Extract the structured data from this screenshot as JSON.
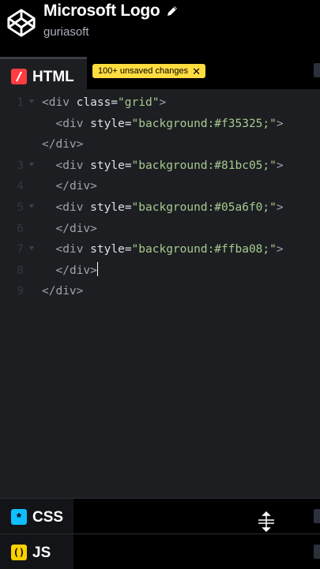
{
  "header": {
    "title": "Microsoft Logo",
    "author": "guriasoft",
    "logo_icon": "codepen-logo-icon",
    "edit_icon": "pencil-icon"
  },
  "html_panel": {
    "label": "HTML",
    "badge_glyph": "/",
    "badge_color": "#ff3c41",
    "unsaved_text": "100+ unsaved changes",
    "unsaved_close": "✕"
  },
  "editor": {
    "lines": [
      {
        "n": "1",
        "fold": true,
        "indent": 0,
        "parts": [
          [
            "tag",
            "<div "
          ],
          [
            "attr",
            "class"
          ],
          [
            "eq",
            "="
          ],
          [
            "str",
            "\"grid\""
          ],
          [
            "tag",
            ">"
          ]
        ]
      },
      {
        "n": "",
        "fold": false,
        "indent": 2,
        "parts": [
          [
            "tag",
            "<div "
          ],
          [
            "attr",
            "style"
          ],
          [
            "eq",
            "="
          ],
          [
            "str",
            "\"background:#f35325;\""
          ],
          [
            "tag",
            ">"
          ]
        ]
      },
      {
        "n": "",
        "fold": false,
        "indent": 0,
        "parts": [
          [
            "tag",
            "</div>"
          ]
        ]
      },
      {
        "n": "3",
        "fold": true,
        "indent": 2,
        "parts": [
          [
            "tag",
            "<div "
          ],
          [
            "attr",
            "style"
          ],
          [
            "eq",
            "="
          ],
          [
            "str",
            "\"background:#81bc05;\""
          ],
          [
            "tag",
            ">"
          ]
        ]
      },
      {
        "n": "4",
        "fold": false,
        "indent": 2,
        "parts": [
          [
            "tag",
            "</div>"
          ]
        ]
      },
      {
        "n": "5",
        "fold": true,
        "indent": 2,
        "parts": [
          [
            "tag",
            "<div "
          ],
          [
            "attr",
            "style"
          ],
          [
            "eq",
            "="
          ],
          [
            "str",
            "\"background:#05a6f0;\""
          ],
          [
            "tag",
            ">"
          ]
        ]
      },
      {
        "n": "6",
        "fold": false,
        "indent": 2,
        "parts": [
          [
            "tag",
            "</div>"
          ]
        ]
      },
      {
        "n": "7",
        "fold": true,
        "indent": 2,
        "parts": [
          [
            "tag",
            "<div "
          ],
          [
            "attr",
            "style"
          ],
          [
            "eq",
            "="
          ],
          [
            "str",
            "\"background:#ffba08;\""
          ],
          [
            "tag",
            ">"
          ]
        ]
      },
      {
        "n": "8",
        "fold": false,
        "indent": 2,
        "parts": [
          [
            "tag",
            "</div>"
          ]
        ],
        "cursor": true
      },
      {
        "n": "9",
        "fold": false,
        "indent": 0,
        "parts": [
          [
            "tag",
            "</div>"
          ]
        ]
      }
    ]
  },
  "css_panel": {
    "label": "CSS",
    "badge_glyph": "*",
    "badge_color": "#0ebeff"
  },
  "js_panel": {
    "label": "JS",
    "badge_glyph": "()",
    "badge_color": "#fcd000"
  },
  "icons": {
    "resize": "resize-handle-icon"
  }
}
